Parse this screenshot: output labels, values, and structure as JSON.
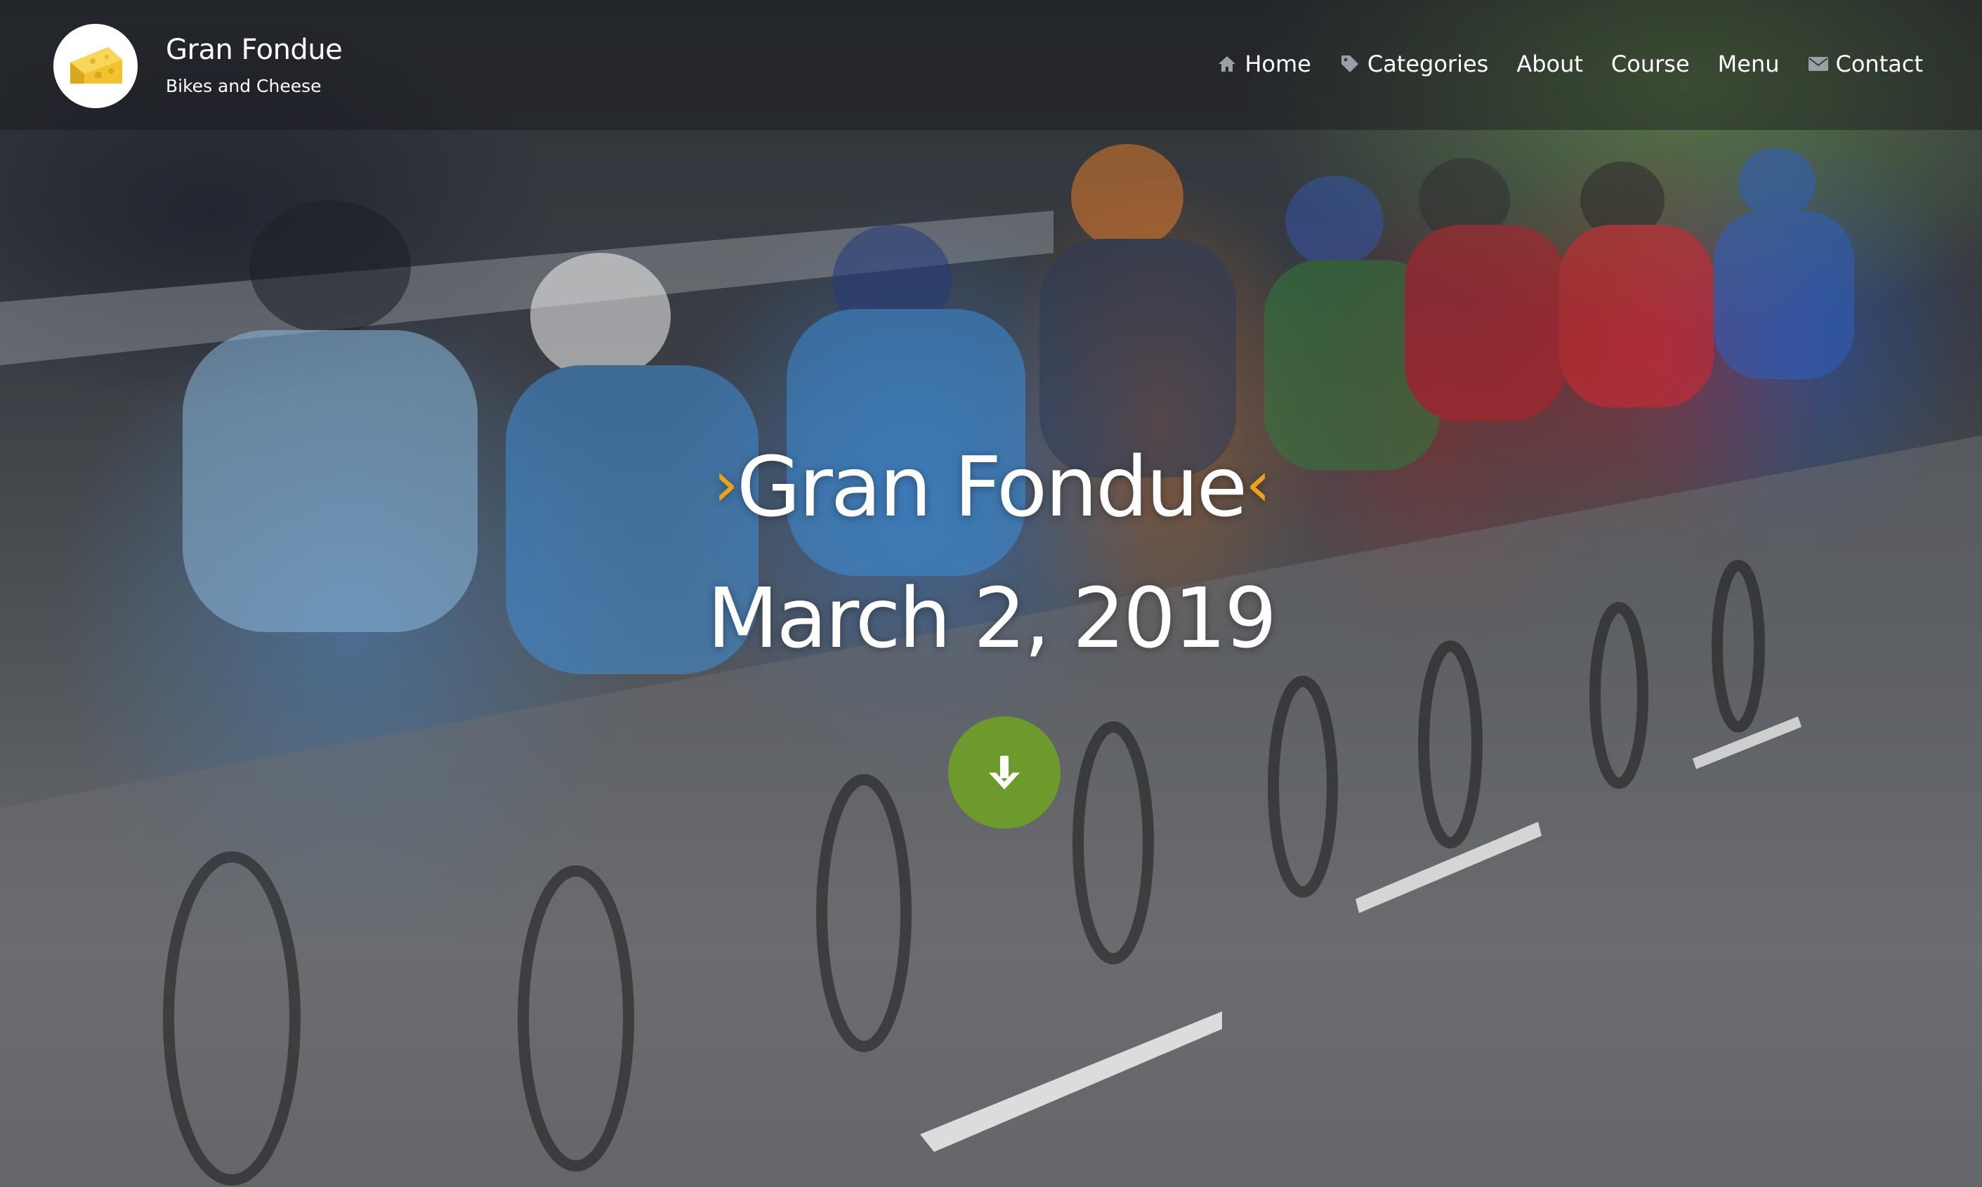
{
  "site": {
    "title": "Gran Fondue",
    "tagline": "Bikes and Cheese",
    "logo_icon": "cheese-icon"
  },
  "nav": {
    "items": [
      {
        "label": "Home",
        "icon": "home-icon"
      },
      {
        "label": "Categories",
        "icon": "tag-icon"
      },
      {
        "label": "About"
      },
      {
        "label": "Course"
      },
      {
        "label": "Menu"
      },
      {
        "label": "Contact",
        "icon": "envelope-icon"
      }
    ]
  },
  "hero": {
    "title": "Gran Fondue",
    "title_prefix": "›",
    "title_suffix": "‹",
    "date": "March 2, 2019",
    "scroll_icon": "arrow-down-icon"
  },
  "colors": {
    "accent_orange": "#f0a11a",
    "button_green": "#6c9a2c",
    "logo_yellow": "#f2c230",
    "text": "#ffffff"
  }
}
